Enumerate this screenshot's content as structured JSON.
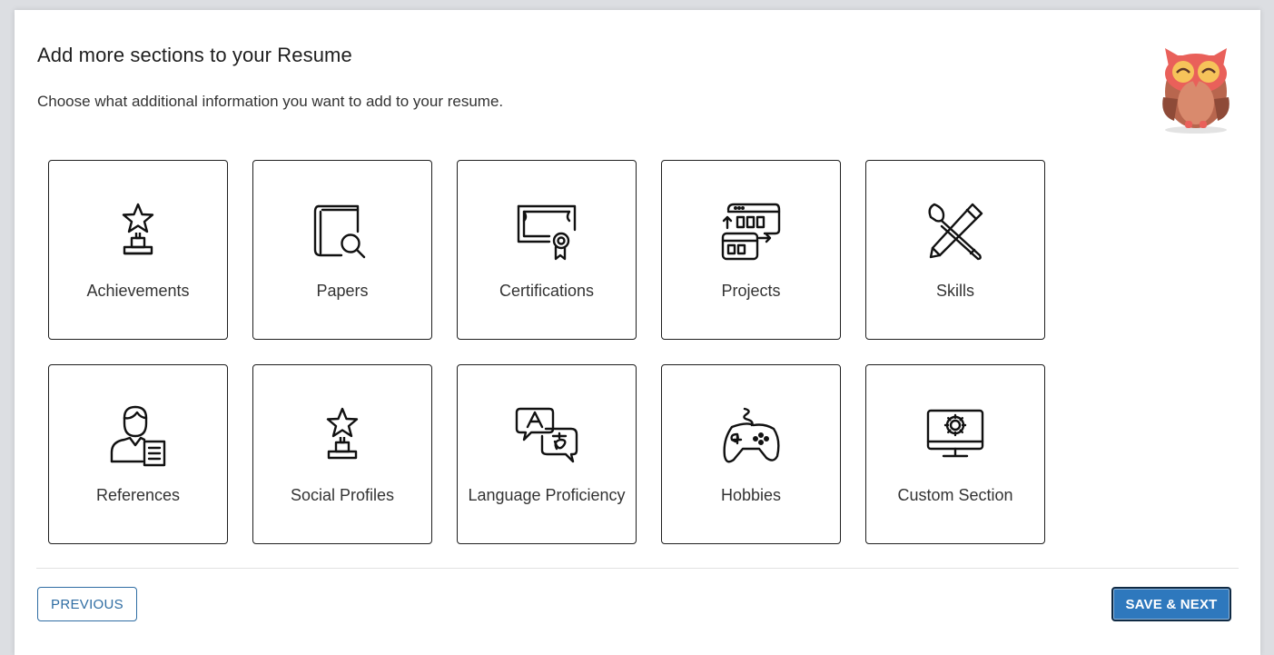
{
  "header": {
    "title": "Add more sections to your Resume",
    "subtitle": "Choose what additional information you want to add to your resume."
  },
  "mascot": {
    "icon": "owl-mascot-icon"
  },
  "sections": [
    {
      "label": "Achievements",
      "icon": "trophy-icon"
    },
    {
      "label": "Papers",
      "icon": "book-search-icon"
    },
    {
      "label": "Certifications",
      "icon": "certificate-icon"
    },
    {
      "label": "Projects",
      "icon": "projects-icon"
    },
    {
      "label": "Skills",
      "icon": "tools-icon"
    },
    {
      "label": "References",
      "icon": "person-document-icon"
    },
    {
      "label": "Social Profiles",
      "icon": "trophy-icon"
    },
    {
      "label": "Language Proficiency",
      "icon": "translate-icon"
    },
    {
      "label": "Hobbies",
      "icon": "gamepad-icon"
    },
    {
      "label": "Custom Section",
      "icon": "monitor-gear-icon"
    }
  ],
  "footer": {
    "previous_label": "PREVIOUS",
    "next_label": "SAVE & NEXT"
  },
  "colors": {
    "primary": "#2e78bd",
    "tile_border": "#1f1f1f",
    "text": "#333333"
  }
}
